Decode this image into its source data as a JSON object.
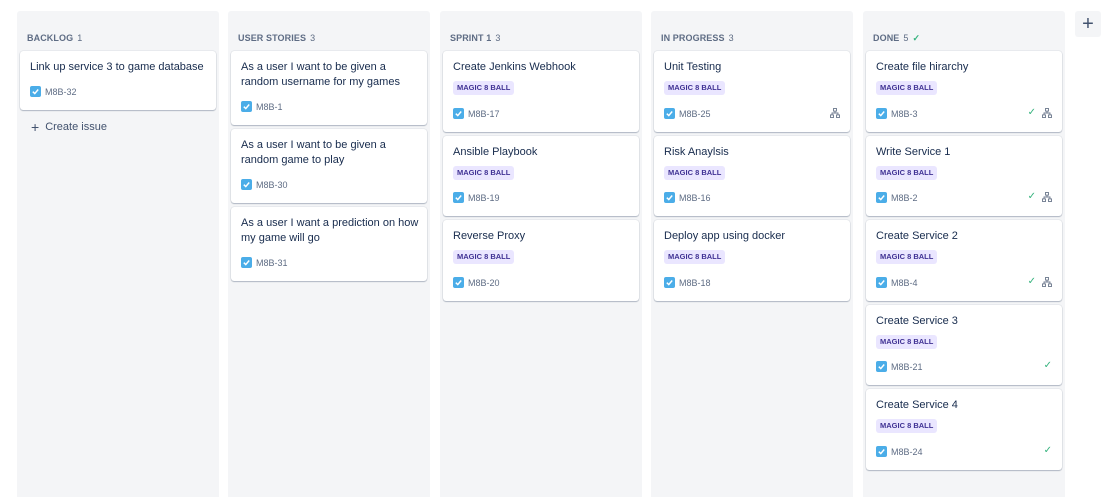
{
  "columns": [
    {
      "title": "BACKLOG",
      "count": "1",
      "cards": [
        {
          "title": "Link up service 3 to game database",
          "key": "M8B-32"
        }
      ],
      "create_label": "Create issue"
    },
    {
      "title": "USER STORIES",
      "count": "3",
      "cards": [
        {
          "title": "As a user I want to be given a random username for my games",
          "key": "M8B-1"
        },
        {
          "title": "As a user I want to be given a random game to play",
          "key": "M8B-30"
        },
        {
          "title": "As a user I want a prediction on how my game will go",
          "key": "M8B-31"
        }
      ]
    },
    {
      "title": "SPRINT 1",
      "count": "3",
      "cards": [
        {
          "title": "Create Jenkins Webhook",
          "label": "MAGIC 8 BALL",
          "key": "M8B-17"
        },
        {
          "title": "Ansible Playbook",
          "label": "MAGIC 8 BALL",
          "key": "M8B-19"
        },
        {
          "title": "Reverse Proxy",
          "label": "MAGIC 8 BALL",
          "key": "M8B-20"
        }
      ]
    },
    {
      "title": "IN PROGRESS",
      "count": "3",
      "cards": [
        {
          "title": "Unit Testing",
          "label": "MAGIC 8 BALL",
          "key": "M8B-25",
          "icons": [
            "subtask-icon"
          ]
        },
        {
          "title": "Risk Anaylsis",
          "label": "MAGIC 8 BALL",
          "key": "M8B-16"
        },
        {
          "title": "Deploy app using docker",
          "label": "MAGIC 8 BALL",
          "key": "M8B-18"
        }
      ]
    },
    {
      "title": "DONE",
      "count": "5",
      "header_icon": "check-icon",
      "cards": [
        {
          "title": "Create file hirarchy",
          "label": "MAGIC 8 BALL",
          "key": "M8B-3",
          "icons": [
            "check-icon",
            "subtask-icon"
          ]
        },
        {
          "title": "Write Service 1",
          "label": "MAGIC 8 BALL",
          "key": "M8B-2",
          "icons": [
            "check-icon",
            "subtask-icon"
          ]
        },
        {
          "title": "Create Service 2",
          "label": "MAGIC 8 BALL",
          "key": "M8B-4",
          "icons": [
            "check-icon",
            "subtask-icon"
          ]
        },
        {
          "title": "Create Service 3",
          "label": "MAGIC 8 BALL",
          "key": "M8B-21",
          "icons": [
            "check-icon"
          ]
        },
        {
          "title": "Create Service 4",
          "label": "MAGIC 8 BALL",
          "key": "M8B-24",
          "icons": [
            "check-icon"
          ]
        }
      ]
    }
  ],
  "add_column_icon": "plus-icon",
  "colors": {
    "column_bg": "#f4f5f7",
    "label_bg": "#eae6ff",
    "label_text": "#403294",
    "story_checkbox": "#4bade8",
    "done_check": "#36b37e"
  }
}
